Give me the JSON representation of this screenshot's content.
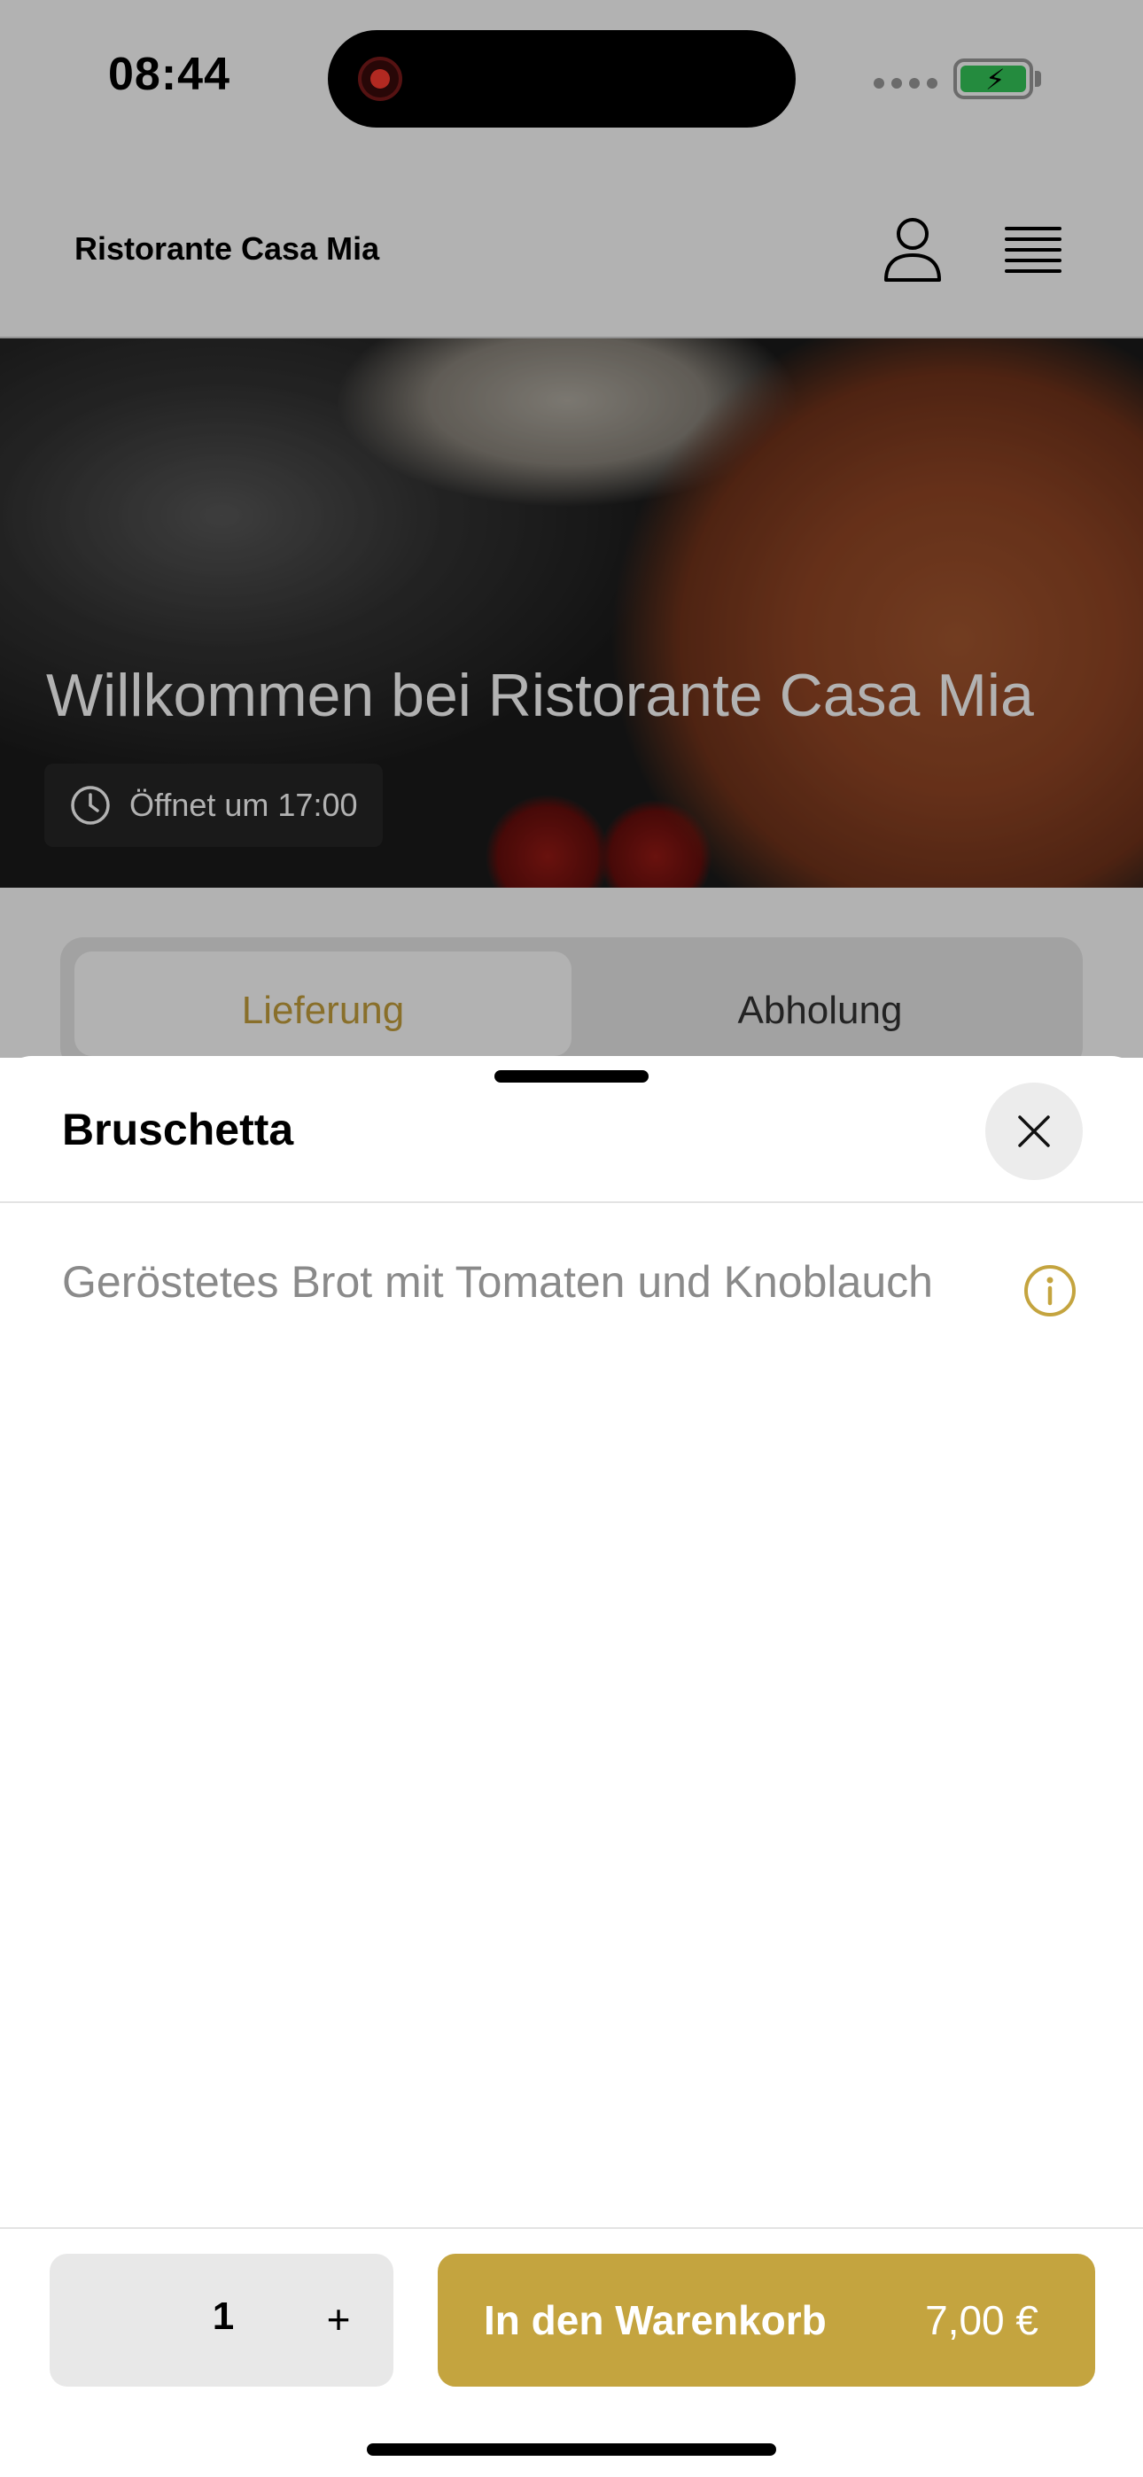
{
  "status_bar": {
    "time": "08:44"
  },
  "header": {
    "restaurant_name": "Ristorante Casa Mia",
    "user_icon": "user-icon",
    "menu_icon": "hamburger-menu-icon"
  },
  "hero": {
    "title": "Willkommen bei Ristorante Casa Mia",
    "opening_text": "Öffnet um 17:00"
  },
  "mode_tabs": [
    {
      "label": "Lieferung",
      "active": true
    },
    {
      "label": "Abholung",
      "active": false
    }
  ],
  "sheet": {
    "title": "Bruschetta",
    "description": "Geröstetes Brot mit Tomaten und Knoblauch",
    "close_icon": "close-icon",
    "info_icon": "info-icon"
  },
  "footer": {
    "quantity": "1",
    "plus_label": "+",
    "add_to_cart_label": "In den Warenkorb",
    "price": "7,00 €"
  },
  "colors": {
    "accent": "#c4a43f",
    "active_tab_text": "#c4a03d",
    "battery": "#34c759",
    "record": "#ff3b30"
  }
}
